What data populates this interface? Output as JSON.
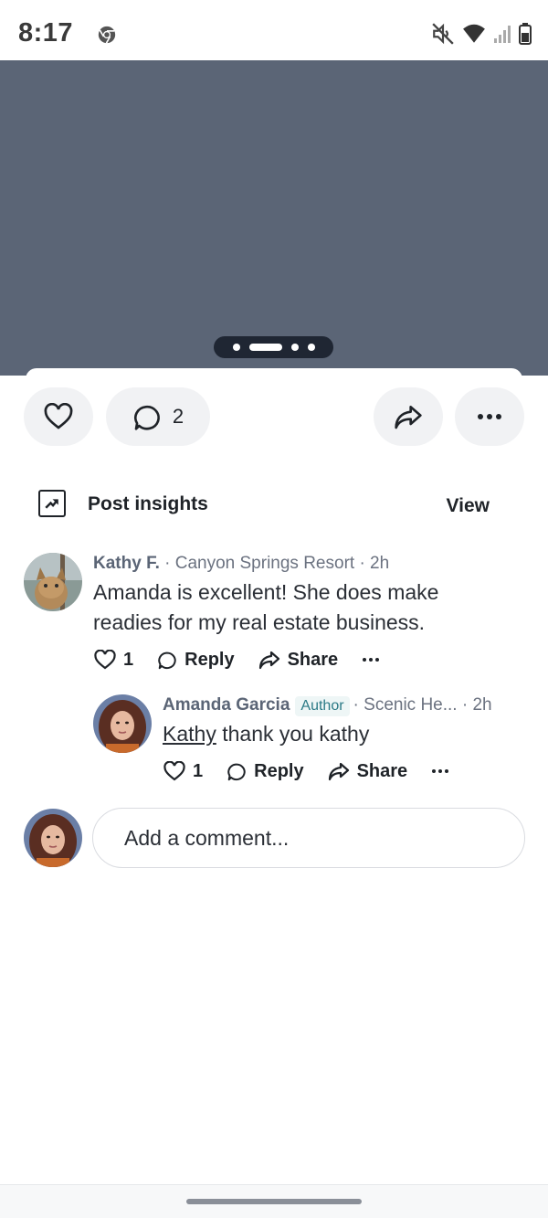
{
  "status_bar": {
    "time": "8:17"
  },
  "post_actions": {
    "comment_count": "2"
  },
  "insights": {
    "label": "Post insights",
    "view_label": "View"
  },
  "comments": [
    {
      "author": "Kathy F.",
      "meta": " · Canyon Springs Resort · 2h",
      "text": "Amanda is excellent! She does make readies for my real estate business.",
      "likes": "1",
      "reply_label": "Reply",
      "share_label": "Share",
      "replies": [
        {
          "author": "Amanda Garcia",
          "badge": "Author",
          "meta": "· Scenic He... · 2h",
          "mention": "Kathy",
          "text": " thank you kathy",
          "likes": "1",
          "reply_label": "Reply",
          "share_label": "Share"
        }
      ]
    }
  ],
  "add_comment": {
    "placeholder": "Add a comment..."
  },
  "colors": {
    "media_bg": "#5b6576",
    "button_bg": "#f1f2f4",
    "badge_text": "#2b7a86"
  }
}
